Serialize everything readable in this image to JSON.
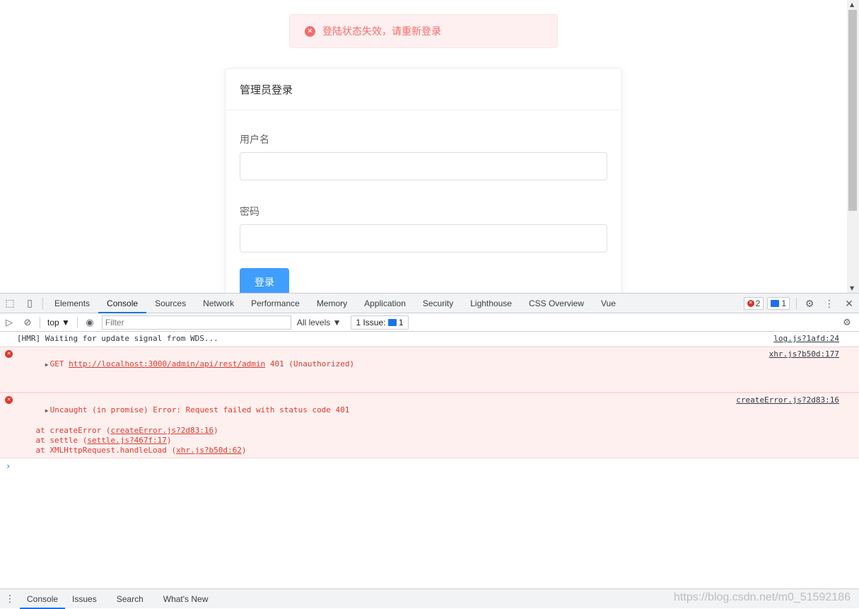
{
  "toast": {
    "message": "登陆状态失效，请重新登录",
    "icon": "close-circle-icon",
    "color": "#f56c6c"
  },
  "login": {
    "title": "管理员登录",
    "username_label": "用户名",
    "username_value": "",
    "password_label": "密码",
    "password_value": "",
    "submit_label": "登录",
    "accent": "#409eff"
  },
  "devtools": {
    "tabs": [
      "Elements",
      "Console",
      "Sources",
      "Network",
      "Performance",
      "Memory",
      "Application",
      "Security",
      "Lighthouse",
      "CSS Overview",
      "Vue"
    ],
    "active_tab": "Console",
    "error_count": "2",
    "message_count": "1",
    "toolbar": {
      "context": "top",
      "filter_placeholder": "Filter",
      "levels": "All levels ▼",
      "issues_label": "1 Issue:",
      "issues_count": "1"
    },
    "logs": {
      "hmr": {
        "text": "[HMR] Waiting for update signal from WDS...",
        "source": "log.js?1afd:24"
      },
      "get": {
        "method": "GET",
        "url": "http://localhost:3000/admin/api/rest/admin",
        "status": "401 (Unauthorized)",
        "source": "xhr.js?b50d:177"
      },
      "uncaught": {
        "text": "Uncaught (in promise) Error: Request failed with status code 401",
        "source": "createError.js?2d83:16",
        "stack": [
          {
            "prefix": "    at createError (",
            "link": "createError.js?2d83:16",
            "suffix": ")"
          },
          {
            "prefix": "    at settle (",
            "link": "settle.js?467f:17",
            "suffix": ")"
          },
          {
            "prefix": "    at XMLHttpRequest.handleLoad (",
            "link": "xhr.js?b50d:62",
            "suffix": ")"
          }
        ]
      }
    },
    "drawer_tabs": [
      "Console",
      "Issues",
      "Search",
      "What's New"
    ]
  },
  "watermark": "https://blog.csdn.net/m0_51592186"
}
